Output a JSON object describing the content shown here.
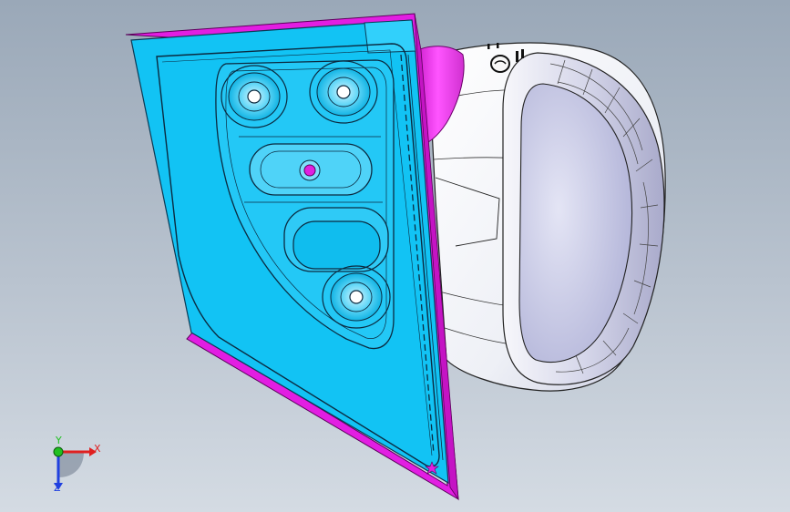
{
  "viewport": {
    "background_top": "#9aa8b8",
    "background_bottom": "#d4dbe3"
  },
  "model": {
    "plate_face_color": "#12c3f4",
    "plate_edge_color": "#e020e0",
    "housing_color": "#f3f3f6",
    "housing_shade_color": "#c9cbe0",
    "lens_color": "#c8c9e8",
    "outline_color": "#111111",
    "mounting_boss_count": 3
  },
  "triad": {
    "x_label": "X",
    "y_label": "Y",
    "z_label": "Z",
    "x_color": "#e02020",
    "y_color": "#20c020",
    "z_color": "#2040e0"
  }
}
